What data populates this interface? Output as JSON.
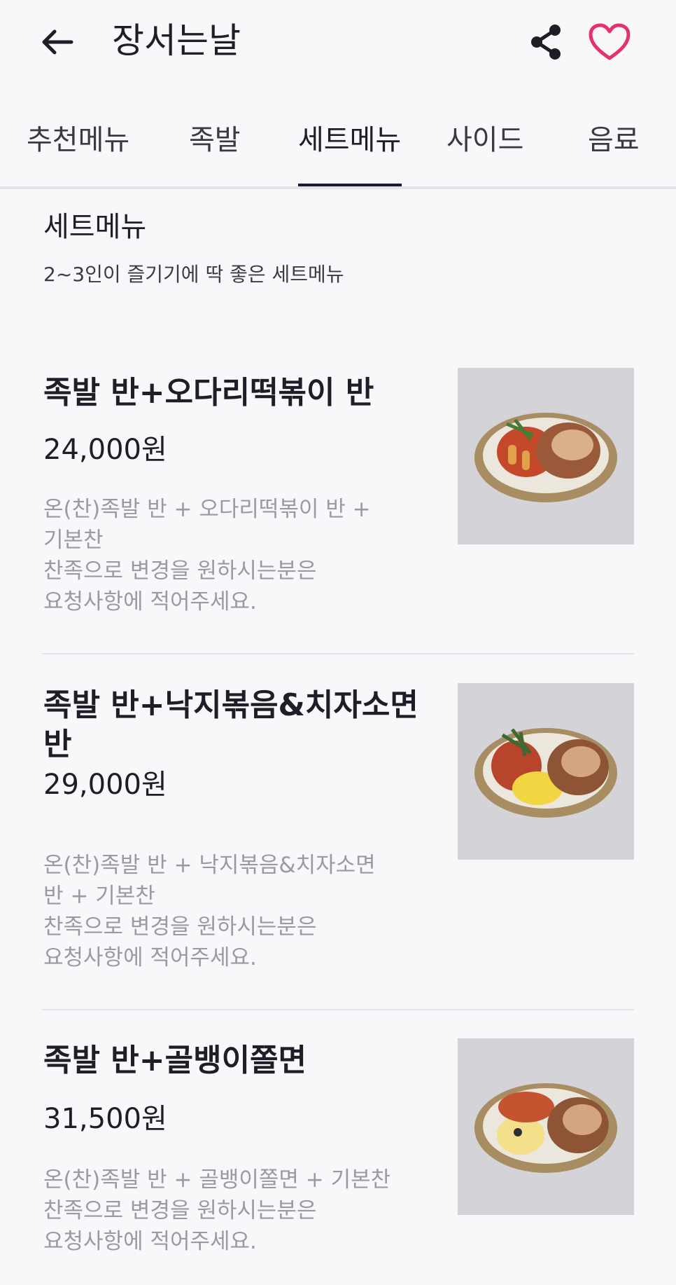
{
  "header": {
    "title": "장서는날",
    "back_icon": "arrow-left-icon",
    "share_icon": "share-icon",
    "heart_icon": "heart-outline-icon",
    "heart_color": "#e2336b"
  },
  "tabs": [
    {
      "label": "추천메뉴",
      "active": false
    },
    {
      "label": "족발",
      "active": false
    },
    {
      "label": "세트메뉴",
      "active": true
    },
    {
      "label": "사이드",
      "active": false
    },
    {
      "label": "음료",
      "active": false
    }
  ],
  "section": {
    "title": "세트메뉴",
    "subtitle": "2~3인이 즐기기에 딱 좋은 세트메뉴"
  },
  "menu_items": [
    {
      "name": "족발 반+오다리떡볶이 반",
      "price": "24,000원",
      "description": "온(찬)족발 반 + 오다리떡볶이 반 + \n기본찬\n찬족으로 변경을 원하시는분은 \n요청사항에 적어주세요."
    },
    {
      "name": "족발 반+낙지볶음&치자소면 반",
      "price": "29,000원",
      "description": "온(찬)족발 반 + 낙지볶음&치자소면 \n반 + 기본찬\n찬족으로 변경을 원하시는분은 \n요청사항에 적어주세요."
    },
    {
      "name": "족발 반+골뱅이쫄면",
      "price": "31,500원",
      "description": "온(찬)족발 반 + 골뱅이쫄면 + 기본찬\n찬족으로 변경을 원하시는분은 \n요청사항에 적어주세요."
    }
  ],
  "colors": {
    "accent_underline": "#1e1632",
    "text_primary": "#1e1e28",
    "text_description": "#9a9aa6",
    "background": "#f8f8fa"
  }
}
